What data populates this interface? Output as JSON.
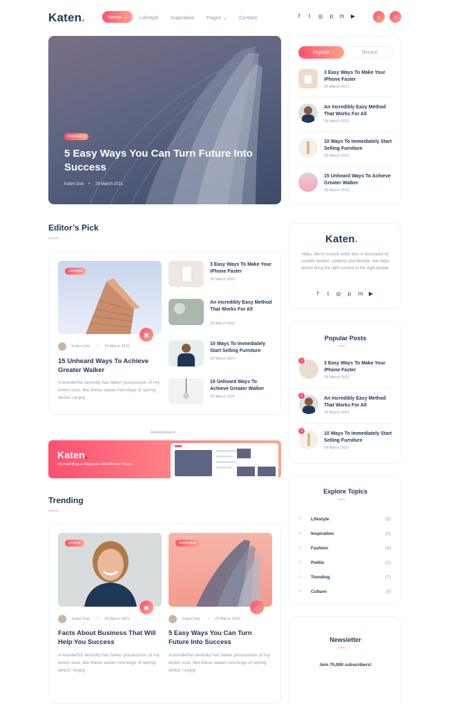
{
  "header": {
    "logo_text": "Katen",
    "logo_dot": ".",
    "nav": [
      "Home",
      "Lifestyle",
      "Inspiration",
      "Pages",
      "Contact"
    ],
    "home_chevron": "⌄",
    "pages_chevron": "⌄",
    "social": [
      "f",
      "t",
      "◎",
      "p",
      "m",
      "▶"
    ],
    "search_icon": "⌕",
    "menu_icon": "≡"
  },
  "hero": {
    "badge": "Inspiration",
    "title": "5 Easy Ways You Can Turn Future Into Success",
    "author": "Katen Doe",
    "date": "29 March 2021"
  },
  "sidebar_tabs": {
    "popular": "Popular",
    "recent": "Recent",
    "posts": [
      {
        "title": "3 Easy Ways To Make Your iPhone Faster",
        "date": "29 March 2021"
      },
      {
        "title": "An Incredibly Easy Method That Works For All",
        "date": "29 March 2021"
      },
      {
        "title": "10 Ways To Immediately Start Selling Furniture",
        "date": "29 March 2021"
      },
      {
        "title": "15 Unheard Ways To Achieve Greater Walker",
        "date": "29 March 2021"
      }
    ]
  },
  "editors_pick": {
    "title": "Editor’s Pick",
    "squiggle": "〰〰",
    "featured": {
      "badge": "Lifestyle",
      "author": "Katen Doe",
      "date": "29 March 2021",
      "title": "15 Unheard Ways To Achieve Greater Walker",
      "excerpt": "A wonderful serenity has taken possession of my entire soul, like these sweet mornings of spring which I enjoy"
    },
    "list": [
      {
        "title": "3 Easy Ways To Make Your iPhone Faster",
        "date": "29 March 2021"
      },
      {
        "title": "An Incredibly Easy Method That Works For All",
        "date": "29 March 2021"
      },
      {
        "title": "10 Ways To Immediately Start Selling Furniture",
        "date": "29 March 2021"
      },
      {
        "title": "15 Unheard Ways To Achieve Greater Walker",
        "date": "29 March 2021"
      }
    ]
  },
  "about": {
    "logo_text": "Katen",
    "logo_dot": ".",
    "text": "Hello, We're content writer who is fascinated by content fashion, celebrity and lifestyle. We helps clients bring the right content to the right people."
  },
  "ad": {
    "label": "Advertisement",
    "logo": "Katen",
    "logo_dot": ".",
    "tagline": "Minimal Blog & Magazine WordPress Theme"
  },
  "popular_posts": {
    "title": "Popular Posts",
    "posts": [
      {
        "num": "1",
        "title": "3 Easy Ways To Make Your iPhone Faster",
        "date": "29 March 2021"
      },
      {
        "num": "2",
        "title": "An Incredibly Easy Method That Works For All",
        "date": "29 March 2021"
      },
      {
        "num": "3",
        "title": "10 Ways To Immediately Start Selling Furniture",
        "date": "29 March 2021"
      }
    ]
  },
  "explore": {
    "title": "Explore Topics",
    "topics": [
      {
        "name": "Lifestyle",
        "count": "(5)"
      },
      {
        "name": "Inspiration",
        "count": "(2)"
      },
      {
        "name": "Fashion",
        "count": "(4)"
      },
      {
        "name": "Politic",
        "count": "(1)"
      },
      {
        "name": "Trending",
        "count": "(7)"
      },
      {
        "name": "Culture",
        "count": "(3)"
      }
    ]
  },
  "trending": {
    "title": "Trending",
    "posts": [
      {
        "badge": "Culture",
        "author": "Katen Doe",
        "date": "29 March 2021",
        "title": "Facts About Business That Will Help You Success",
        "excerpt": "A wonderful serenity has taken possession of my entire soul, like these sweet mornings of spring which I enjoy"
      },
      {
        "badge": "Inspiration",
        "author": "Katen Doe",
        "date": "29 March 2021",
        "title": "5 Easy Ways You Can Turn Future Into Success",
        "excerpt": "A wonderful serenity has taken possession of my entire soul, like these sweet mornings of spring which I enjoy"
      }
    ]
  },
  "newsletter": {
    "title": "Newsletter",
    "subtitle": "Join 70,000 subscribers!"
  },
  "colors": {
    "accent": "#fe4f70",
    "accent2": "#ffa387",
    "heading": "#203656",
    "muted": "#8f9bad"
  }
}
